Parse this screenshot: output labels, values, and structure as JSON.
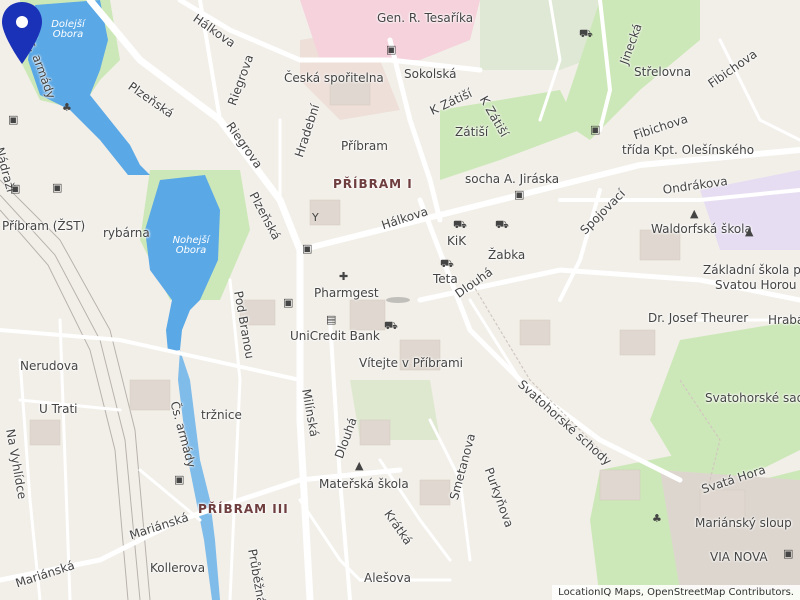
{
  "map": {
    "districts": [
      "PŘÍBRAM I",
      "PŘÍBRAM III"
    ],
    "water": [
      "Dolejší Obora",
      "Nohejší Obora"
    ],
    "streets": [
      "Hálkova",
      "Čs. armády",
      "Plzeňská",
      "Riegrova",
      "Hradební",
      "Sokolská",
      "K Zátiší",
      "K Zátiší",
      "Nádraží",
      "Riegrova",
      "Plzeňská",
      "Hálkova",
      "Jinecká",
      "Fibichova",
      "Fibichova",
      "třída Kpt. Olešínského",
      "Ondrákova",
      "Spojovací",
      "Dlouhá",
      "Pod Branou",
      "Čs. armády",
      "Milínská",
      "Svatohorské schody",
      "Dlouhá",
      "Smetanova",
      "Purkyňova",
      "Krátká",
      "Mariánská",
      "Mariánská",
      "Na Vyhlídce",
      "Kollerova",
      "Průběžná",
      "Alešova",
      "Nerudova",
      "U Trati",
      "Hrabákova",
      "Svatá Hora"
    ],
    "places": [
      "Gen. R. Tesaříka",
      "Česká spořitelna",
      "Zátiší",
      "Příbram",
      "Střelovna",
      "socha A. Jiráska",
      "Příbram (ŽST)",
      "rybárna",
      "KiK",
      "Žabka",
      "Waldorfská škola",
      "Teta",
      "Pharmgest",
      "Základní škola pod",
      "Svatou Horou",
      "Dr. Josef Theurer",
      "UniCredit Bank",
      "Vítejte v Příbrami",
      "Svatohorské sady",
      "tržnice",
      "Mateřská škola",
      "Mariánský sloup",
      "VIA NOVA"
    ],
    "icons": [
      "bus-stop-icon",
      "shop-icon",
      "school-icon",
      "bar-icon",
      "pharmacy-icon",
      "bank-icon",
      "tree-icon",
      "location-pin-icon"
    ],
    "attribution": "LocationIQ Maps, OpenStreetMap Contributors.",
    "colors": {
      "land": "#f2efe9",
      "water": "#5aa8e6",
      "park": "#cde8b8",
      "residential": "#e8e3dd",
      "commercial": "#eedfd9",
      "hospital": "#f5d2dc",
      "education": "#e6ddf2",
      "pin": "#1a32b8",
      "district_label": "#6e3d3d"
    }
  }
}
